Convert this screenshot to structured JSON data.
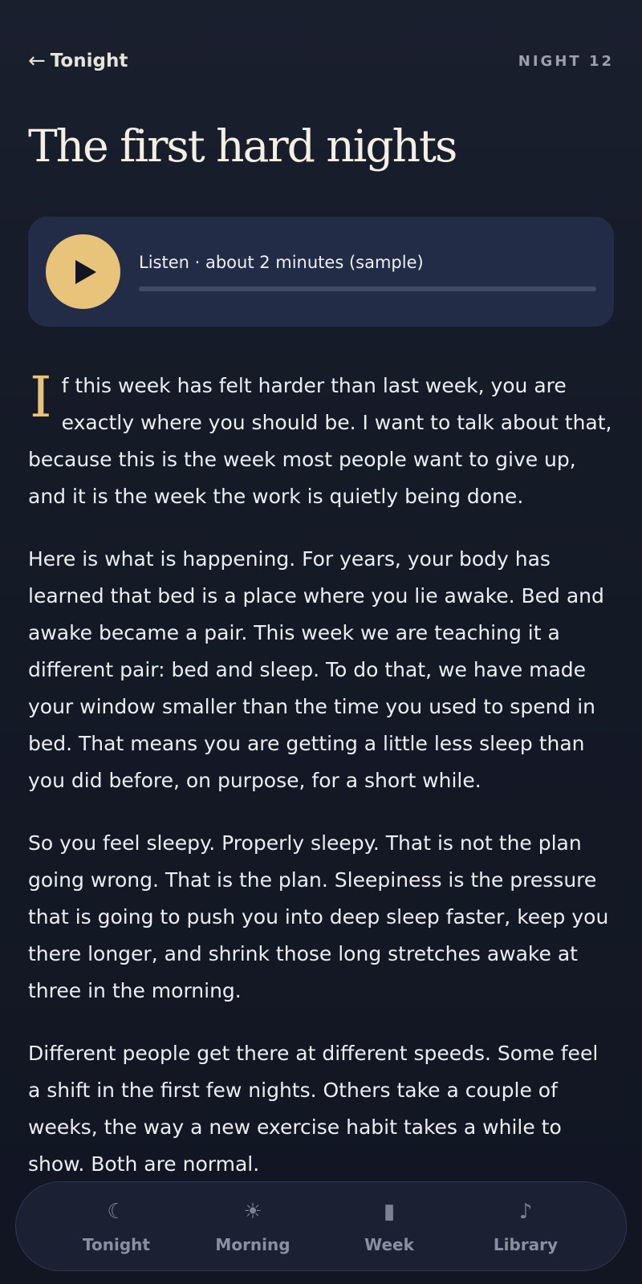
{
  "header": {
    "back_arrow": "←",
    "back_label": "Tonight",
    "night_label": "NIGHT 12"
  },
  "title": "The first hard nights",
  "player": {
    "label": "Listen · about 2 minutes (sample)",
    "progress": 0
  },
  "article": {
    "dropcap": "I",
    "first_paragraph_rest": "f this week has felt harder than last week, you are exactly where you should be. I want to talk about that, because this is the week most people want to give up, and it is the week the work is quietly being done.",
    "paragraphs": [
      "Here is what is happening. For years, your body has learned that bed is a place where you lie awake. Bed and awake became a pair. This week we are teaching it a different pair: bed and sleep. To do that, we have made your window smaller than the time you used to spend in bed. That means you are getting a little less sleep than you did before, on purpose, for a short while.",
      "So you feel sleepy. Properly sleepy. That is not the plan going wrong. That is the plan. Sleepiness is the pressure that is going to push you into deep sleep faster, keep you there longer, and shrink those long stretches awake at three in the morning.",
      "Different people get there at different speeds. Some feel a shift in the first few nights. Others take a couple of weeks, the way a new exercise habit takes a while to show. Both are normal."
    ]
  },
  "nav": {
    "items": [
      {
        "label": "Tonight",
        "icon": "☾",
        "icon_name": "moon-icon"
      },
      {
        "label": "Morning",
        "icon": "☀",
        "icon_name": "sun-icon"
      },
      {
        "label": "Week",
        "icon": "▮",
        "icon_name": "bar-icon"
      },
      {
        "label": "Library",
        "icon": "♪",
        "icon_name": "music-note-icon"
      }
    ]
  },
  "colors": {
    "accent": "#e8c47a",
    "background": "#151a27",
    "card": "#232c46"
  }
}
